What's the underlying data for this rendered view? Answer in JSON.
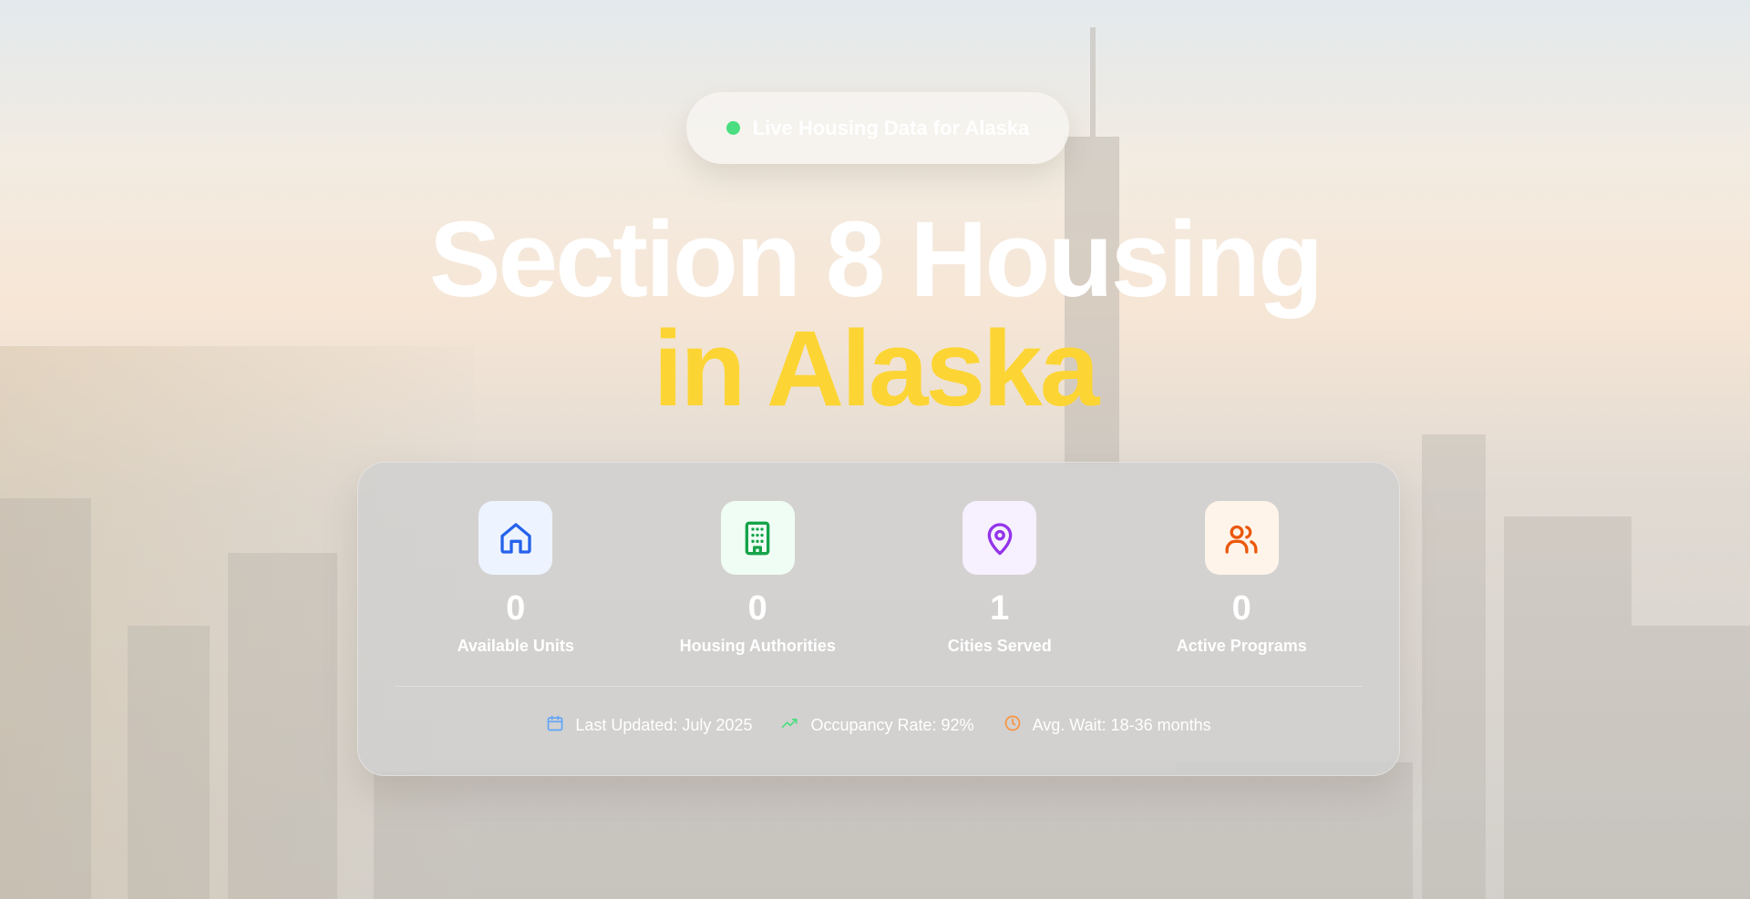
{
  "badge": {
    "text": "Live Housing Data for Alaska"
  },
  "hero": {
    "line1": "Section 8 Housing",
    "line2": "in Alaska"
  },
  "stats": [
    {
      "icon": "home-icon",
      "value": "0",
      "label": "Available Units",
      "color": "#2563eb",
      "bg": "#eef4ff"
    },
    {
      "icon": "building-icon",
      "value": "0",
      "label": "Housing Authorities",
      "color": "#16a34a",
      "bg": "#effdf4"
    },
    {
      "icon": "map-pin-icon",
      "value": "1",
      "label": "Cities Served",
      "color": "#9333ea",
      "bg": "#f6f0ff"
    },
    {
      "icon": "users-icon",
      "value": "0",
      "label": "Active Programs",
      "color": "#ea580c",
      "bg": "#fff4ea"
    }
  ],
  "footer": [
    {
      "icon": "calendar-icon",
      "text": "Last Updated: July 2025",
      "color": "#60a5fa"
    },
    {
      "icon": "trending-up-icon",
      "text": "Occupancy Rate: 92%",
      "color": "#4ade80"
    },
    {
      "icon": "clock-icon",
      "text": "Avg. Wait: 18-36 months",
      "color": "#fb923c"
    }
  ]
}
